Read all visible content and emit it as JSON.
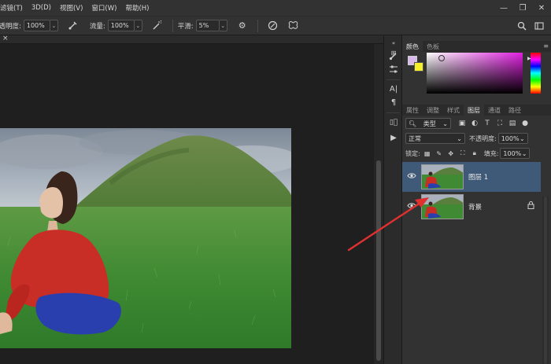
{
  "menu": [
    "滤镜(T)",
    "3D(D)",
    "视图(V)",
    "窗口(W)",
    "帮助(H)"
  ],
  "window_controls": [
    "—",
    "❐",
    "✕"
  ],
  "options": {
    "opacity_label": "不透明度:",
    "opacity_value": "100%",
    "flow_label": "流量:",
    "flow_value": "100%",
    "smooth_label": "平滑:",
    "smooth_value": "5%"
  },
  "doc_tab_close": "×",
  "panels": {
    "color_tabs": [
      "颜色",
      "色板"
    ],
    "layer_tabs": [
      "属性",
      "调整",
      "样式",
      "图层",
      "通道",
      "路径"
    ],
    "filter_kind": "类型",
    "blend_mode": "正常",
    "opacity_label": "不透明度:",
    "opacity_value": "100%",
    "lock_label": "锁定:",
    "fill_label": "填充:",
    "fill_value": "100%",
    "layers": [
      {
        "name": "图层 1",
        "selected": true,
        "visible": true,
        "locked": false
      },
      {
        "name": "背景",
        "selected": false,
        "visible": true,
        "locked": true
      }
    ]
  },
  "colors": {
    "foreground": "#d8b8ea",
    "background": "#f6f02a",
    "annotation_arrow": "#e03030",
    "selected_layer": "#3f5a78"
  }
}
